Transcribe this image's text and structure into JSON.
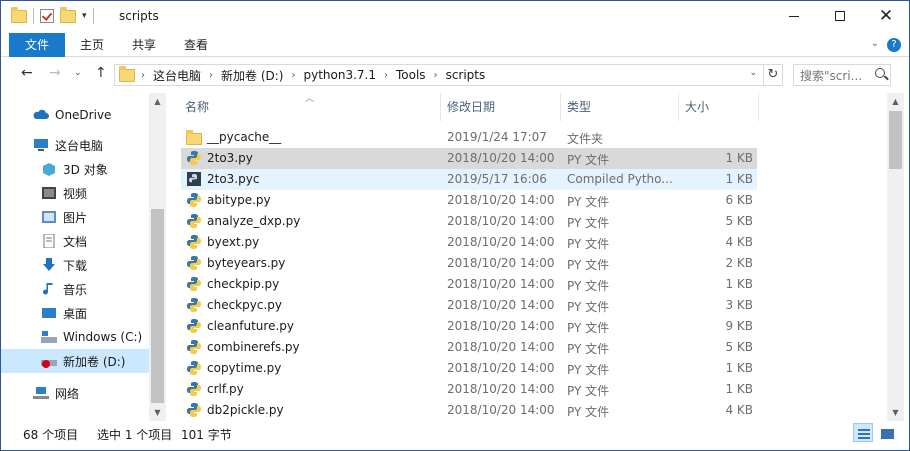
{
  "window": {
    "title": "scripts"
  },
  "ribbon": {
    "tabs": [
      "文件",
      "主页",
      "共享",
      "查看"
    ]
  },
  "address": {
    "crumbs": [
      "这台电脑",
      "新加卷 (D:)",
      "python3.7.1",
      "Tools",
      "scripts"
    ],
    "search_placeholder": "搜索\"scri..."
  },
  "nav": {
    "items": [
      {
        "label": "OneDrive",
        "icon": "cloud-icon"
      },
      {
        "label": "这台电脑",
        "icon": "computer-icon"
      },
      {
        "label": "3D 对象",
        "icon": "3d-objects-icon"
      },
      {
        "label": "视频",
        "icon": "video-icon"
      },
      {
        "label": "图片",
        "icon": "pictures-icon"
      },
      {
        "label": "文档",
        "icon": "documents-icon"
      },
      {
        "label": "下载",
        "icon": "download-icon"
      },
      {
        "label": "音乐",
        "icon": "music-icon"
      },
      {
        "label": "桌面",
        "icon": "desktop-icon"
      },
      {
        "label": "Windows (C:)",
        "icon": "drive-c-icon"
      },
      {
        "label": "新加卷 (D:)",
        "icon": "drive-d-icon"
      },
      {
        "label": "网络",
        "icon": "network-icon"
      }
    ]
  },
  "columns": [
    "名称",
    "修改日期",
    "类型",
    "大小"
  ],
  "files": [
    {
      "name": "__pycache__",
      "date": "2019/1/24 17:07",
      "type": "文件夹",
      "size": ""
    },
    {
      "name": "2to3.py",
      "date": "2018/10/20 14:00",
      "type": "PY 文件",
      "size": "1 KB"
    },
    {
      "name": "2to3.pyc",
      "date": "2019/5/17 16:06",
      "type": "Compiled Pytho...",
      "size": "1 KB"
    },
    {
      "name": "abitype.py",
      "date": "2018/10/20 14:00",
      "type": "PY 文件",
      "size": "6 KB"
    },
    {
      "name": "analyze_dxp.py",
      "date": "2018/10/20 14:00",
      "type": "PY 文件",
      "size": "5 KB"
    },
    {
      "name": "byext.py",
      "date": "2018/10/20 14:00",
      "type": "PY 文件",
      "size": "4 KB"
    },
    {
      "name": "byteyears.py",
      "date": "2018/10/20 14:00",
      "type": "PY 文件",
      "size": "2 KB"
    },
    {
      "name": "checkpip.py",
      "date": "2018/10/20 14:00",
      "type": "PY 文件",
      "size": "1 KB"
    },
    {
      "name": "checkpyc.py",
      "date": "2018/10/20 14:00",
      "type": "PY 文件",
      "size": "3 KB"
    },
    {
      "name": "cleanfuture.py",
      "date": "2018/10/20 14:00",
      "type": "PY 文件",
      "size": "9 KB"
    },
    {
      "name": "combinerefs.py",
      "date": "2018/10/20 14:00",
      "type": "PY 文件",
      "size": "5 KB"
    },
    {
      "name": "copytime.py",
      "date": "2018/10/20 14:00",
      "type": "PY 文件",
      "size": "1 KB"
    },
    {
      "name": "crlf.py",
      "date": "2018/10/20 14:00",
      "type": "PY 文件",
      "size": "1 KB"
    },
    {
      "name": "db2pickle.py",
      "date": "2018/10/20 14:00",
      "type": "PY 文件",
      "size": "4 KB"
    }
  ],
  "status": {
    "count": "68 个项目",
    "selected": "选中 1 个项目",
    "size": "101 字节"
  },
  "colors": {
    "accent": "#1979ca",
    "selected_row": "#d9d9d9",
    "hover_row": "#e5f3ff",
    "nav_selected": "#cce8ff"
  }
}
